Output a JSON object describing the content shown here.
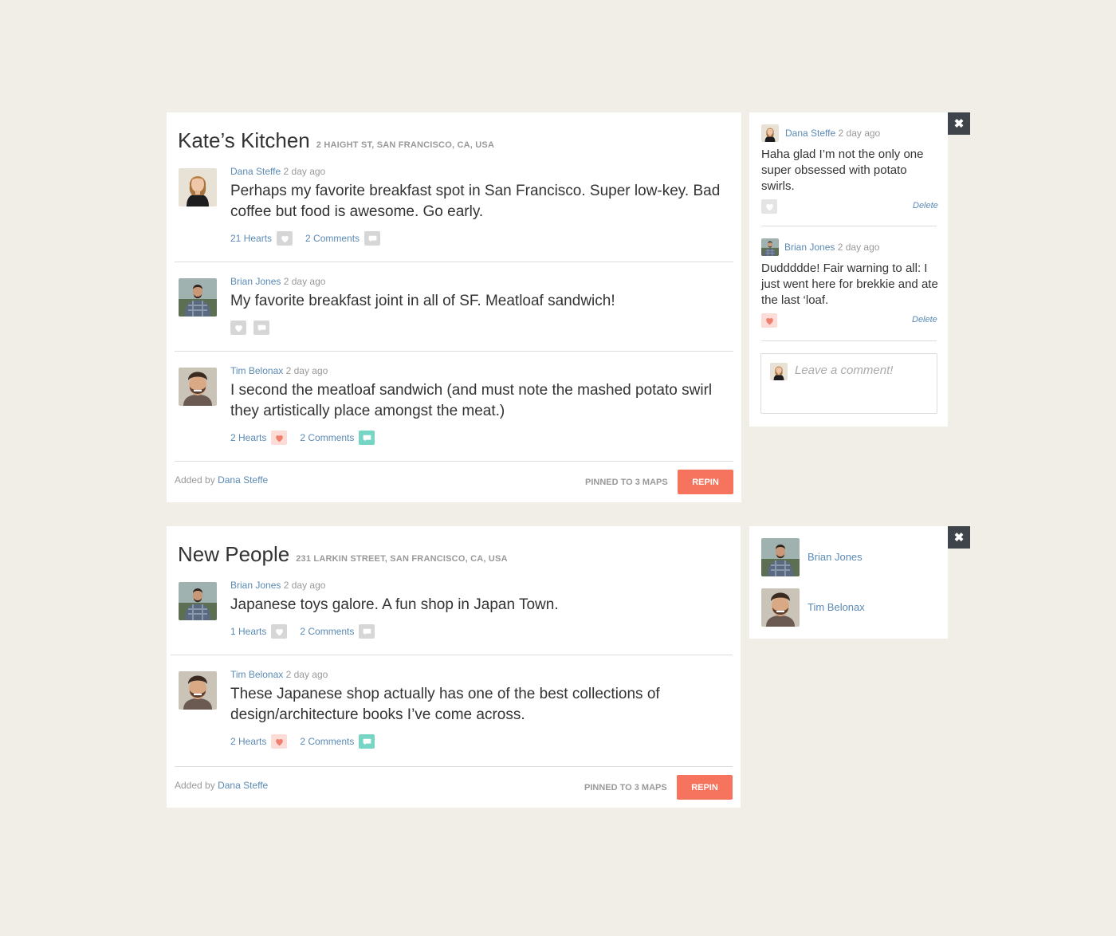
{
  "cards": [
    {
      "name": "Kate’s Kitchen",
      "address": "2 Haight St, San Francisco, CA, USA",
      "posts": [
        {
          "user": "Dana Steffe",
          "time": "2 day ago",
          "text": "Perhaps my favorite breakfast spot in San Francisco. Super low-key. Bad coffee but food is awesome. Go early.",
          "hearts": "21 Hearts",
          "comments": "2 Comments"
        },
        {
          "user": "Brian Jones",
          "time": "2 day ago",
          "text": "My favorite breakfast joint in all of SF. Meatloaf sandwich!"
        },
        {
          "user": "Tim Belonax",
          "time": "2 day ago",
          "text": "I second the meatloaf sandwich (and must note the mashed potato swirl they artistically place amongst the meat.)",
          "hearts": "2 Hearts",
          "comments": "2 Comments"
        }
      ],
      "added_by_prefix": "Added by",
      "added_by_user": "Dana Steffe",
      "pinned": "Pinned to 3 maps",
      "repin": "Repin"
    },
    {
      "name": "New People",
      "address": "231 Larkin Street, San Francisco, CA, USA",
      "posts": [
        {
          "user": "Brian Jones",
          "time": "2 day ago",
          "text": "Japanese toys galore. A fun shop in Japan Town.",
          "hearts": "1 Hearts",
          "comments": "2 Comments"
        },
        {
          "user": "Tim Belonax",
          "time": "2 day ago",
          "text": "These Japanese shop actually has one of the best collections of design/architecture books I’ve come across.",
          "hearts": "2 Hearts",
          "comments": "2 Comments"
        }
      ],
      "added_by_prefix": "Added by",
      "added_by_user": "Dana Steffe",
      "pinned": "Pinned to 3 maps",
      "repin": "Repin"
    }
  ],
  "comments_panel": {
    "close": "✖",
    "comments": [
      {
        "user": "Dana Steffe",
        "time": "2 day ago",
        "text": "Haha glad I’m not the only one super obsessed with potato swirls.",
        "delete": "Delete"
      },
      {
        "user": "Brian Jones",
        "time": "2 day ago",
        "text": "Duddddde! Fair warning to all: I just went here for brekkie and ate the last ‘loaf.",
        "delete": "Delete"
      }
    ],
    "placeholder": "Leave a comment!"
  },
  "hearts_panel": {
    "close": "✖",
    "users": [
      "Brian Jones",
      "Tim Belonax"
    ]
  },
  "colors": {
    "background": "#f0eee6",
    "link": "#5b8ab5",
    "repin": "#f6735d",
    "heart_active": "#f17f6f",
    "comment_active": "#76d5c4",
    "close_button": "#3e4449"
  },
  "icons": [
    "heart-icon",
    "comment-bubble-icon",
    "close-icon"
  ]
}
